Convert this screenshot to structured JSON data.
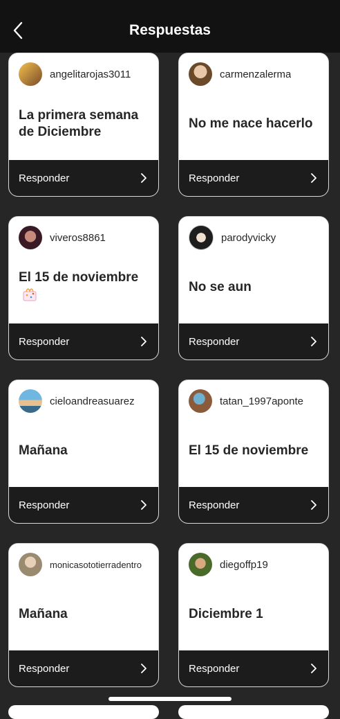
{
  "header": {
    "title": "Respuestas",
    "back_icon": "chevron-left-icon"
  },
  "respond_label": "Responder",
  "cards": [
    {
      "username": "angelitarojas3011",
      "answer": "La primera semana de Diciembre",
      "avatar_color": "#c8a25a"
    },
    {
      "username": "carmenzalerma",
      "answer": "No me nace hacerlo",
      "avatar_color": "#b88e6e"
    },
    {
      "username": "viveros8861",
      "answer": "El 15 de noviembre",
      "answer_icon": "gift-emoji-icon",
      "avatar_color": "#7a3b4c"
    },
    {
      "username": "parodyvicky",
      "answer": "No se aun",
      "avatar_color": "#2b2b2b"
    },
    {
      "username": "cieloandreasuarez",
      "answer": "Mañana",
      "avatar_color": "#4a8ab0"
    },
    {
      "username": "tatan_1997aponte",
      "answer": "El 15 de noviembre",
      "avatar_color": "#8a6b4a"
    },
    {
      "username": "monicasototierradentro",
      "answer": "Mañana",
      "avatar_color": "#b7a48c"
    },
    {
      "username": "diegoffp19",
      "answer": "Diciembre 1",
      "avatar_color": "#5b7a3c"
    }
  ]
}
